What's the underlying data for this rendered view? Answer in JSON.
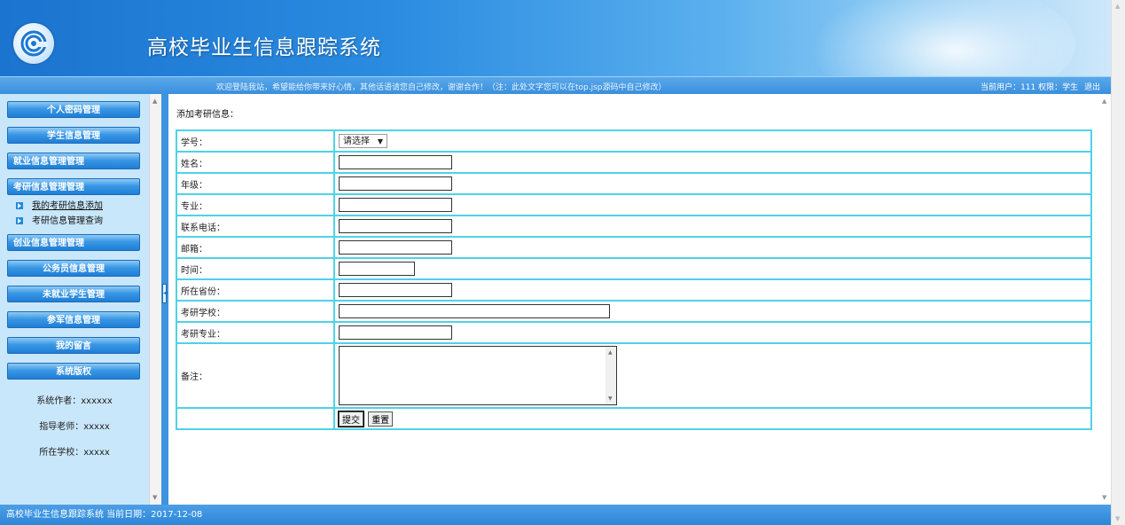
{
  "header": {
    "title": "高校毕业生信息跟踪系统",
    "welcome": "欢迎登陆我站，希望能给你带来好心情，其他话语请您自己修改，谢谢合作！（注：此处文字您可以在top.jsp源码中自己修改）",
    "current_user": "当前用户：111 权限：学生",
    "logout": "退出"
  },
  "sidebar": {
    "menus": [
      {
        "label": "个人密码管理"
      },
      {
        "label": "学生信息管理"
      },
      {
        "label": "就业信息管理管理"
      },
      {
        "label": "考研信息管理管理"
      },
      {
        "label": "创业信息管理管理"
      },
      {
        "label": "公务员信息管理"
      },
      {
        "label": "未就业学生管理"
      },
      {
        "label": "参军信息管理"
      },
      {
        "label": "我的留言"
      },
      {
        "label": "系统版权"
      }
    ],
    "submenu": [
      {
        "label": "我的考研信息添加"
      },
      {
        "label": "考研信息管理查询"
      }
    ],
    "credits": {
      "author": "系统作者：xxxxxx",
      "teacher": "指导老师：xxxxx",
      "school": "所在学校：xxxxx"
    }
  },
  "main": {
    "title": "添加考研信息：",
    "fields": {
      "student_id": "学号：",
      "name": "姓名：",
      "grade": "年级：",
      "major": "专业：",
      "phone": "联系电话：",
      "email": "邮箱：",
      "time": "时间：",
      "province": "所在省份：",
      "school": "考研学校：",
      "exam_major": "考研专业：",
      "remark": "备注："
    },
    "student_select": "请选择",
    "submit": "提交",
    "reset": "重置"
  },
  "footer": {
    "text": "高校毕业生信息跟踪系统 当前日期：2017-12-08"
  }
}
